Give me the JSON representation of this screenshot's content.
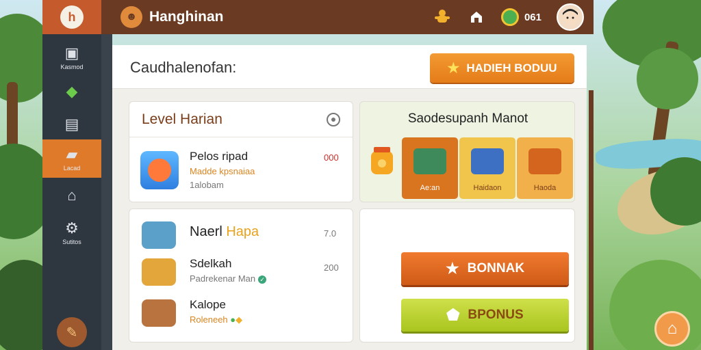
{
  "header": {
    "logo_text": "h",
    "title": "Hanghinan",
    "coins": "061"
  },
  "sidebar": {
    "items": [
      {
        "label": "Kasmod",
        "icon": "chest-icon"
      },
      {
        "label": "",
        "icon": "cash-icon"
      },
      {
        "label": "",
        "icon": "cabinet-icon"
      },
      {
        "label": "Lacad",
        "icon": "camera-icon",
        "active": true
      },
      {
        "label": "",
        "icon": "house-icon"
      },
      {
        "label": "Sutitos",
        "icon": "gear-icon"
      }
    ]
  },
  "main": {
    "title": "Caudhalenofan:",
    "header_button": "HADIEH BODUU"
  },
  "level_card": {
    "title": "Level Harian",
    "item_title": "Pelos ripad",
    "item_subtitle": "Madde kpsnaiaa",
    "item_detail": "1alobam",
    "item_value": "000"
  },
  "shop_card": {
    "title": "Saodesupanh Manot",
    "tiles": [
      {
        "label": "Ae:an"
      },
      {
        "label": "Haidaon"
      },
      {
        "label": "Haoda"
      }
    ]
  },
  "list_card": {
    "rows": [
      {
        "title": "Naerl",
        "title_accent": "Hapa",
        "subtitle": "",
        "value": "7.0"
      },
      {
        "title": "Sdelkah",
        "subtitle": "Padrekenar Man",
        "value": "200"
      },
      {
        "title": "Kalope",
        "subtitle": "Roleneeh",
        "value": ""
      }
    ]
  },
  "actions": {
    "primary_button": "BONNAK",
    "secondary_button": "BPONUS"
  },
  "colors": {
    "topbar": "#6a3b22",
    "sidebar": "#2e3640",
    "accent_orange": "#e07a2b",
    "accent_green": "#a9c51e"
  }
}
